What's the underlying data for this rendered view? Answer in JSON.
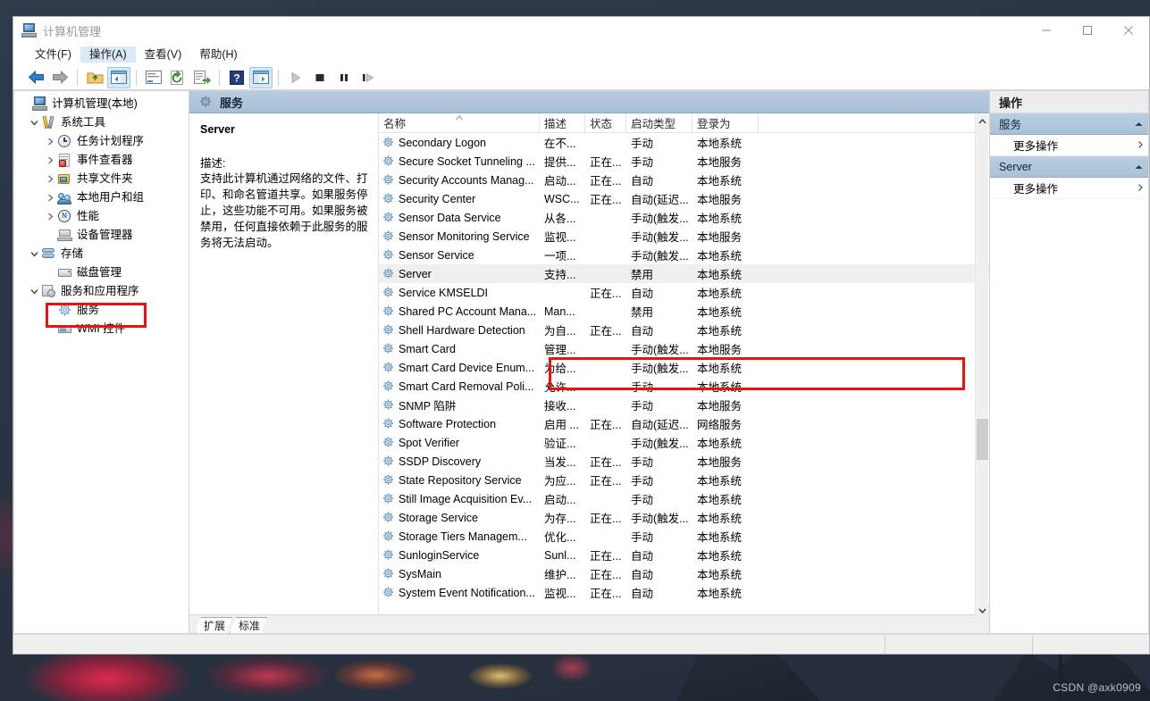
{
  "window": {
    "title": "计算机管理",
    "title_icon": "computer-icon",
    "controls": {
      "minimize": "minimize-icon",
      "maximize": "maximize-icon",
      "close": "close-icon"
    }
  },
  "menubar": [
    {
      "label": "文件(F)",
      "active": false
    },
    {
      "label": "操作(A)",
      "active": true
    },
    {
      "label": "查看(V)",
      "active": false
    },
    {
      "label": "帮助(H)",
      "active": false
    }
  ],
  "toolbar": [
    {
      "name": "back-icon",
      "sep_after": false
    },
    {
      "name": "forward-icon",
      "sep_after": true
    },
    {
      "name": "up-folder-icon",
      "sep_after": false
    },
    {
      "name": "show-hide-tree-icon",
      "sep_after": true,
      "pressed": true
    },
    {
      "name": "properties-icon",
      "sep_after": false
    },
    {
      "name": "refresh-icon",
      "sep_after": false
    },
    {
      "name": "export-list-icon",
      "sep_after": true
    },
    {
      "name": "help-icon",
      "sep_after": false
    },
    {
      "name": "show-action-pane-icon",
      "sep_after": true,
      "pressed": true
    },
    {
      "name": "start-service-icon",
      "sep_after": false,
      "disabled": true
    },
    {
      "name": "stop-service-icon",
      "sep_after": false
    },
    {
      "name": "pause-service-icon",
      "sep_after": false
    },
    {
      "name": "restart-service-icon",
      "sep_after": false
    }
  ],
  "tree": [
    {
      "label": "计算机管理(本地)",
      "indent": 0,
      "chevron": "",
      "icon": "computer-icon"
    },
    {
      "label": "系统工具",
      "indent": 1,
      "chevron": "expanded",
      "icon": "system-tools-icon"
    },
    {
      "label": "任务计划程序",
      "indent": 2,
      "chevron": "collapsed",
      "icon": "task-scheduler-icon"
    },
    {
      "label": "事件查看器",
      "indent": 2,
      "chevron": "collapsed",
      "icon": "event-viewer-icon"
    },
    {
      "label": "共享文件夹",
      "indent": 2,
      "chevron": "collapsed",
      "icon": "shared-folders-icon"
    },
    {
      "label": "本地用户和组",
      "indent": 2,
      "chevron": "collapsed",
      "icon": "local-users-groups-icon"
    },
    {
      "label": "性能",
      "indent": 2,
      "chevron": "collapsed",
      "icon": "performance-icon"
    },
    {
      "label": "设备管理器",
      "indent": 2,
      "chevron": "",
      "icon": "device-manager-icon"
    },
    {
      "label": "存储",
      "indent": 1,
      "chevron": "expanded",
      "icon": "storage-icon"
    },
    {
      "label": "磁盘管理",
      "indent": 2,
      "chevron": "",
      "icon": "disk-management-icon"
    },
    {
      "label": "服务和应用程序",
      "indent": 1,
      "chevron": "expanded",
      "icon": "services-apps-icon"
    },
    {
      "label": "服务",
      "indent": 2,
      "chevron": "",
      "icon": "service-gear-icon",
      "highlighted": true
    },
    {
      "label": "WMI 控件",
      "indent": 2,
      "chevron": "",
      "icon": "wmi-control-icon"
    }
  ],
  "center": {
    "header": {
      "title": "服务",
      "icon": "service-gear-icon"
    },
    "detail": {
      "service_name": "Server",
      "description_label": "描述:",
      "description": "支持此计算机通过网络的文件、打印、和命名管道共享。如果服务停止，这些功能不可用。如果服务被禁用，任何直接依赖于此服务的服务将无法启动。"
    },
    "columns": [
      {
        "label": "名称",
        "width": 180,
        "sorted": true
      },
      {
        "label": "描述",
        "width": 51,
        "sorted": false
      },
      {
        "label": "状态",
        "width": 46,
        "sorted": false
      },
      {
        "label": "启动类型",
        "width": 74,
        "sorted": false
      },
      {
        "label": "登录为",
        "width": 74,
        "sorted": false
      }
    ],
    "rows": [
      {
        "name": "Secondary Logon",
        "desc": "在不...",
        "status": "",
        "startup": "手动",
        "logon": "本地系统"
      },
      {
        "name": "Secure Socket Tunneling ...",
        "desc": "提供...",
        "status": "正在...",
        "startup": "手动",
        "logon": "本地服务"
      },
      {
        "name": "Security Accounts Manag...",
        "desc": "启动...",
        "status": "正在...",
        "startup": "自动",
        "logon": "本地系统"
      },
      {
        "name": "Security Center",
        "desc": "WSC...",
        "status": "正在...",
        "startup": "自动(延迟...",
        "logon": "本地服务"
      },
      {
        "name": "Sensor Data Service",
        "desc": "从各...",
        "status": "",
        "startup": "手动(触发...",
        "logon": "本地系统"
      },
      {
        "name": "Sensor Monitoring Service",
        "desc": "监视...",
        "status": "",
        "startup": "手动(触发...",
        "logon": "本地服务"
      },
      {
        "name": "Sensor Service",
        "desc": "一项...",
        "status": "",
        "startup": "手动(触发...",
        "logon": "本地系统"
      },
      {
        "name": "Server",
        "desc": "支持...",
        "status": "",
        "startup": "禁用",
        "logon": "本地系统",
        "selected": true
      },
      {
        "name": "Service KMSELDI",
        "desc": "",
        "status": "正在...",
        "startup": "自动",
        "logon": "本地系统"
      },
      {
        "name": "Shared PC Account Mana...",
        "desc": "Man...",
        "status": "",
        "startup": "禁用",
        "logon": "本地系统"
      },
      {
        "name": "Shell Hardware Detection",
        "desc": "为自...",
        "status": "正在...",
        "startup": "自动",
        "logon": "本地系统"
      },
      {
        "name": "Smart Card",
        "desc": "管理...",
        "status": "",
        "startup": "手动(触发...",
        "logon": "本地服务"
      },
      {
        "name": "Smart Card Device Enum...",
        "desc": "为给...",
        "status": "",
        "startup": "手动(触发...",
        "logon": "本地系统"
      },
      {
        "name": "Smart Card Removal Poli...",
        "desc": "允许...",
        "status": "",
        "startup": "手动",
        "logon": "本地系统"
      },
      {
        "name": "SNMP 陷阱",
        "desc": "接收...",
        "status": "",
        "startup": "手动",
        "logon": "本地服务"
      },
      {
        "name": "Software Protection",
        "desc": "启用 ...",
        "status": "正在...",
        "startup": "自动(延迟...",
        "logon": "网络服务"
      },
      {
        "name": "Spot Verifier",
        "desc": "验证...",
        "status": "",
        "startup": "手动(触发...",
        "logon": "本地系统"
      },
      {
        "name": "SSDP Discovery",
        "desc": "当发...",
        "status": "正在...",
        "startup": "手动",
        "logon": "本地服务"
      },
      {
        "name": "State Repository Service",
        "desc": "为应...",
        "status": "正在...",
        "startup": "手动",
        "logon": "本地系统"
      },
      {
        "name": "Still Image Acquisition Ev...",
        "desc": "启动...",
        "status": "",
        "startup": "手动",
        "logon": "本地系统"
      },
      {
        "name": "Storage Service",
        "desc": "为存...",
        "status": "正在...",
        "startup": "手动(触发...",
        "logon": "本地系统"
      },
      {
        "name": "Storage Tiers Managem...",
        "desc": "优化...",
        "status": "",
        "startup": "手动",
        "logon": "本地系统"
      },
      {
        "name": "SunloginService",
        "desc": "Sunl...",
        "status": "正在...",
        "startup": "自动",
        "logon": "本地系统"
      },
      {
        "name": "SysMain",
        "desc": "维护...",
        "status": "正在...",
        "startup": "自动",
        "logon": "本地系统"
      },
      {
        "name": "System Event Notification...",
        "desc": "监视...",
        "status": "正在...",
        "startup": "自动",
        "logon": "本地系统"
      }
    ],
    "tabs": [
      {
        "label": "扩展",
        "active": false
      },
      {
        "label": "标准",
        "active": true
      }
    ],
    "scrollbar": {
      "up": "chevron-up-icon",
      "down": "chevron-down-icon"
    }
  },
  "actions": {
    "title": "操作",
    "groups": [
      {
        "header": "服务",
        "items": [
          {
            "label": "更多操作",
            "submenu": true
          }
        ]
      },
      {
        "header": "Server",
        "items": [
          {
            "label": "更多操作",
            "submenu": true
          }
        ]
      }
    ]
  },
  "annotations": {
    "color": "#ee1111",
    "boxes": [
      {
        "name": "tree-services-highlight"
      },
      {
        "name": "server-row-highlight"
      }
    ]
  },
  "desktop": {
    "watermark": "CSDN @axk0909"
  }
}
